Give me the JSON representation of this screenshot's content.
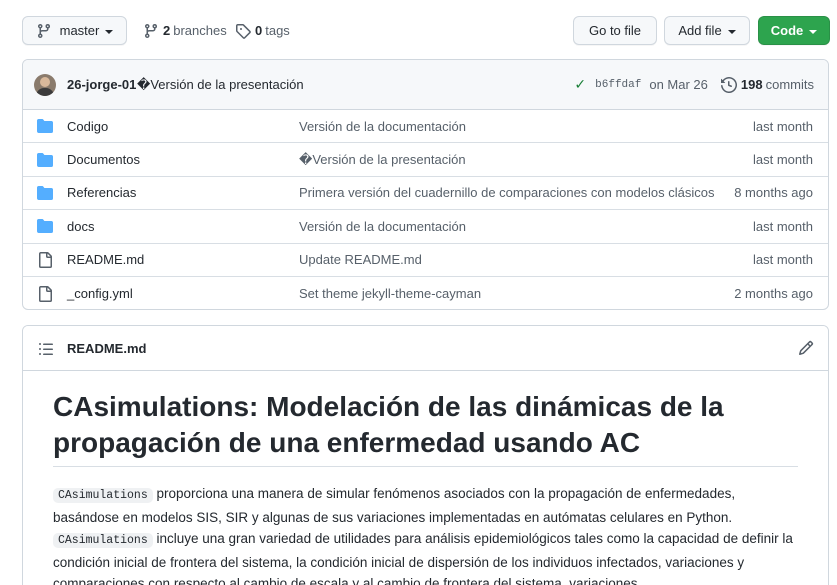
{
  "toolbar": {
    "branch": "master",
    "branches_count": "2",
    "branches_label": "branches",
    "tags_count": "0",
    "tags_label": "tags",
    "go_to_file": "Go to file",
    "add_file": "Add file",
    "code": "Code"
  },
  "latest_commit": {
    "author": "26-jorge-01",
    "message": "�Versión de la presentación",
    "sha": "b6ffdaf",
    "date": "on Mar 26",
    "commits_count": "198",
    "commits_label": "commits"
  },
  "files": [
    {
      "icon": "folder-icon",
      "name": "Codigo",
      "message": "Versión de la documentación",
      "age": "last month"
    },
    {
      "icon": "folder-icon",
      "name": "Documentos",
      "message": "�Versión de la presentación",
      "age": "last month"
    },
    {
      "icon": "folder-icon",
      "name": "Referencias",
      "message": "Primera versión del cuadernillo de comparaciones con modelos clásicos",
      "age": "8 months ago"
    },
    {
      "icon": "folder-icon",
      "name": "docs",
      "message": "Versión de la documentación",
      "age": "last month"
    },
    {
      "icon": "file-icon",
      "name": "README.md",
      "message": "Update README.md",
      "age": "last month"
    },
    {
      "icon": "file-icon",
      "name": "_config.yml",
      "message": "Set theme jekyll-theme-cayman",
      "age": "2 months ago"
    }
  ],
  "readme": {
    "filename": "README.md",
    "heading": "CAsimulations: Modelación de las dinámicas de la propagación de una enfermedad usando AC",
    "code_term": "CAsimulations",
    "p1_text": " proporciona una manera de simular fenómenos asociados con la propagación de enfermedades, basándose en modelos SIS, SIR y algunas de sus variaciones implementadas en autómatas celulares en Python.",
    "p2_text": " incluye una gran variedad de utilidades para análisis epidemiológicos tales como la capacidad de definir la condición inicial de frontera del sistema, la condición inicial de dispersión de los individuos infectados, variaciones y comparaciones con respecto al cambio de escala y al cambio de frontera del sistema, variaciones"
  },
  "colors": {
    "accent_green": "#2da44e",
    "folder_blue": "#54aeff",
    "border": "#d0d7de"
  }
}
